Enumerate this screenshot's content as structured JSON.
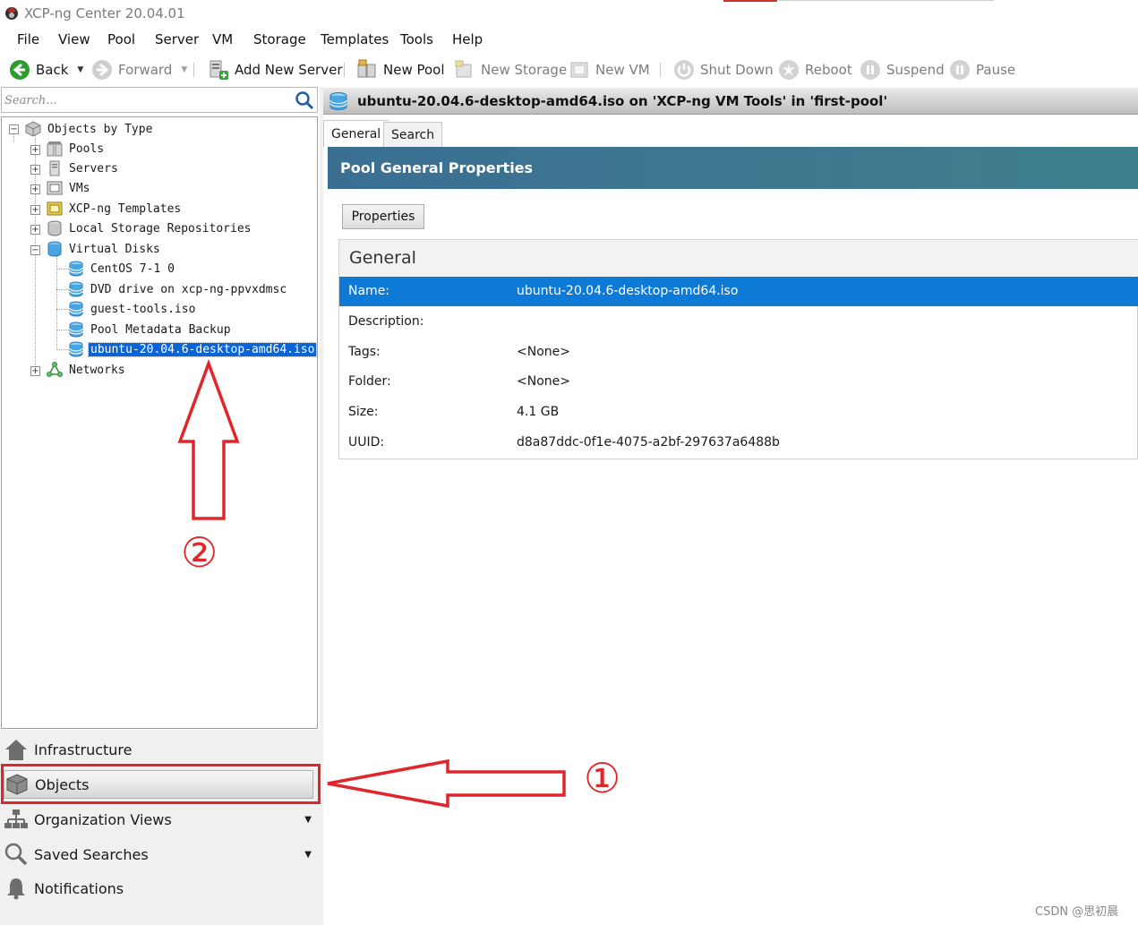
{
  "window": {
    "title": "XCP-ng Center 20.04.01"
  },
  "menu": [
    "File",
    "View",
    "Pool",
    "Server",
    "VM",
    "Storage",
    "Templates",
    "Tools",
    "Help"
  ],
  "toolbar": {
    "back": "Back",
    "forward": "Forward",
    "add_new_server": "Add New Server",
    "new_pool": "New Pool",
    "new_storage": "New Storage",
    "new_vm": "New VM",
    "shut_down": "Shut Down",
    "reboot": "Reboot",
    "suspend": "Suspend",
    "pause": "Pause"
  },
  "search": {
    "placeholder": "Search..."
  },
  "tree": {
    "root": "Objects by Type",
    "pools": "Pools",
    "servers": "Servers",
    "vms": "VMs",
    "templates": "XCP-ng Templates",
    "local_storage": "Local Storage Repositories",
    "virtual_disks": "Virtual Disks",
    "disks": [
      "CentOS 7-1 0",
      "DVD drive on xcp-ng-ppvxdmsc",
      "guest-tools.iso",
      "Pool Metadata Backup",
      "ubuntu-20.04.6-desktop-amd64.iso"
    ],
    "networks": "Networks"
  },
  "nav": {
    "infrastructure": "Infrastructure",
    "objects": "Objects",
    "organization_views": "Organization Views",
    "saved_searches": "Saved Searches",
    "notifications": "Notifications"
  },
  "header": {
    "title": "ubuntu-20.04.6-desktop-amd64.iso on 'XCP-ng VM Tools' in 'first-pool'"
  },
  "tabs": [
    "General",
    "Search"
  ],
  "banner": {
    "title": "Pool General Properties"
  },
  "properties_button": "Properties",
  "general": {
    "title": "General",
    "rows": [
      {
        "label": "Name:",
        "value": "ubuntu-20.04.6-desktop-amd64.iso"
      },
      {
        "label": "Description:",
        "value": ""
      },
      {
        "label": "Tags:",
        "value": "<None>"
      },
      {
        "label": "Folder:",
        "value": "<None>"
      },
      {
        "label": "Size:",
        "value": "4.1 GB"
      },
      {
        "label": "UUID:",
        "value": "d8a87ddc-0f1e-4075-a2bf-297637a6488b"
      }
    ]
  },
  "annotations": {
    "step1": "①",
    "step2": "②",
    "color": "#e0252b"
  },
  "watermark": "CSDN @思初晨"
}
